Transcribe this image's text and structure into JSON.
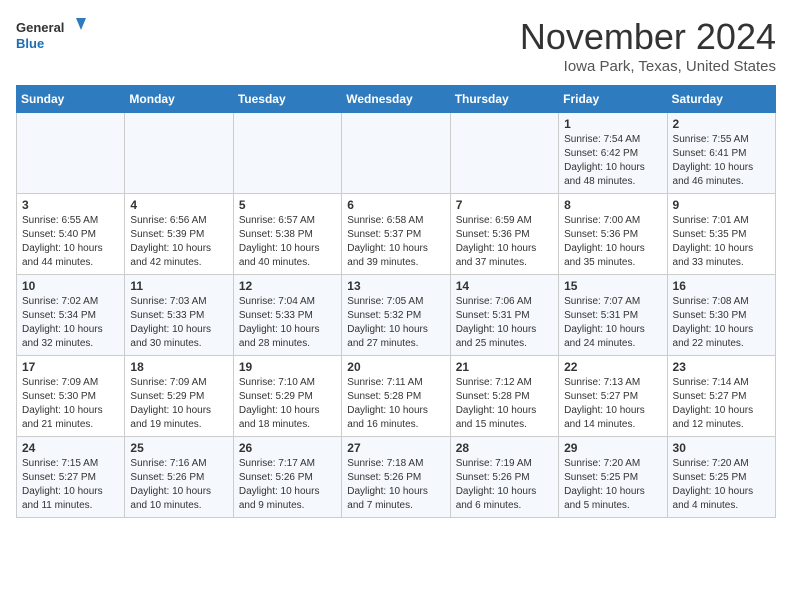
{
  "header": {
    "logo": {
      "general": "General",
      "blue": "Blue"
    },
    "month": "November 2024",
    "location": "Iowa Park, Texas, United States"
  },
  "weekdays": [
    "Sunday",
    "Monday",
    "Tuesday",
    "Wednesday",
    "Thursday",
    "Friday",
    "Saturday"
  ],
  "weeks": [
    [
      {
        "day": "",
        "info": ""
      },
      {
        "day": "",
        "info": ""
      },
      {
        "day": "",
        "info": ""
      },
      {
        "day": "",
        "info": ""
      },
      {
        "day": "",
        "info": ""
      },
      {
        "day": "1",
        "info": "Sunrise: 7:54 AM\nSunset: 6:42 PM\nDaylight: 10 hours and 48 minutes."
      },
      {
        "day": "2",
        "info": "Sunrise: 7:55 AM\nSunset: 6:41 PM\nDaylight: 10 hours and 46 minutes."
      }
    ],
    [
      {
        "day": "3",
        "info": "Sunrise: 6:55 AM\nSunset: 5:40 PM\nDaylight: 10 hours and 44 minutes."
      },
      {
        "day": "4",
        "info": "Sunrise: 6:56 AM\nSunset: 5:39 PM\nDaylight: 10 hours and 42 minutes."
      },
      {
        "day": "5",
        "info": "Sunrise: 6:57 AM\nSunset: 5:38 PM\nDaylight: 10 hours and 40 minutes."
      },
      {
        "day": "6",
        "info": "Sunrise: 6:58 AM\nSunset: 5:37 PM\nDaylight: 10 hours and 39 minutes."
      },
      {
        "day": "7",
        "info": "Sunrise: 6:59 AM\nSunset: 5:36 PM\nDaylight: 10 hours and 37 minutes."
      },
      {
        "day": "8",
        "info": "Sunrise: 7:00 AM\nSunset: 5:36 PM\nDaylight: 10 hours and 35 minutes."
      },
      {
        "day": "9",
        "info": "Sunrise: 7:01 AM\nSunset: 5:35 PM\nDaylight: 10 hours and 33 minutes."
      }
    ],
    [
      {
        "day": "10",
        "info": "Sunrise: 7:02 AM\nSunset: 5:34 PM\nDaylight: 10 hours and 32 minutes."
      },
      {
        "day": "11",
        "info": "Sunrise: 7:03 AM\nSunset: 5:33 PM\nDaylight: 10 hours and 30 minutes."
      },
      {
        "day": "12",
        "info": "Sunrise: 7:04 AM\nSunset: 5:33 PM\nDaylight: 10 hours and 28 minutes."
      },
      {
        "day": "13",
        "info": "Sunrise: 7:05 AM\nSunset: 5:32 PM\nDaylight: 10 hours and 27 minutes."
      },
      {
        "day": "14",
        "info": "Sunrise: 7:06 AM\nSunset: 5:31 PM\nDaylight: 10 hours and 25 minutes."
      },
      {
        "day": "15",
        "info": "Sunrise: 7:07 AM\nSunset: 5:31 PM\nDaylight: 10 hours and 24 minutes."
      },
      {
        "day": "16",
        "info": "Sunrise: 7:08 AM\nSunset: 5:30 PM\nDaylight: 10 hours and 22 minutes."
      }
    ],
    [
      {
        "day": "17",
        "info": "Sunrise: 7:09 AM\nSunset: 5:30 PM\nDaylight: 10 hours and 21 minutes."
      },
      {
        "day": "18",
        "info": "Sunrise: 7:09 AM\nSunset: 5:29 PM\nDaylight: 10 hours and 19 minutes."
      },
      {
        "day": "19",
        "info": "Sunrise: 7:10 AM\nSunset: 5:29 PM\nDaylight: 10 hours and 18 minutes."
      },
      {
        "day": "20",
        "info": "Sunrise: 7:11 AM\nSunset: 5:28 PM\nDaylight: 10 hours and 16 minutes."
      },
      {
        "day": "21",
        "info": "Sunrise: 7:12 AM\nSunset: 5:28 PM\nDaylight: 10 hours and 15 minutes."
      },
      {
        "day": "22",
        "info": "Sunrise: 7:13 AM\nSunset: 5:27 PM\nDaylight: 10 hours and 14 minutes."
      },
      {
        "day": "23",
        "info": "Sunrise: 7:14 AM\nSunset: 5:27 PM\nDaylight: 10 hours and 12 minutes."
      }
    ],
    [
      {
        "day": "24",
        "info": "Sunrise: 7:15 AM\nSunset: 5:27 PM\nDaylight: 10 hours and 11 minutes."
      },
      {
        "day": "25",
        "info": "Sunrise: 7:16 AM\nSunset: 5:26 PM\nDaylight: 10 hours and 10 minutes."
      },
      {
        "day": "26",
        "info": "Sunrise: 7:17 AM\nSunset: 5:26 PM\nDaylight: 10 hours and 9 minutes."
      },
      {
        "day": "27",
        "info": "Sunrise: 7:18 AM\nSunset: 5:26 PM\nDaylight: 10 hours and 7 minutes."
      },
      {
        "day": "28",
        "info": "Sunrise: 7:19 AM\nSunset: 5:26 PM\nDaylight: 10 hours and 6 minutes."
      },
      {
        "day": "29",
        "info": "Sunrise: 7:20 AM\nSunset: 5:25 PM\nDaylight: 10 hours and 5 minutes."
      },
      {
        "day": "30",
        "info": "Sunrise: 7:20 AM\nSunset: 5:25 PM\nDaylight: 10 hours and 4 minutes."
      }
    ]
  ]
}
